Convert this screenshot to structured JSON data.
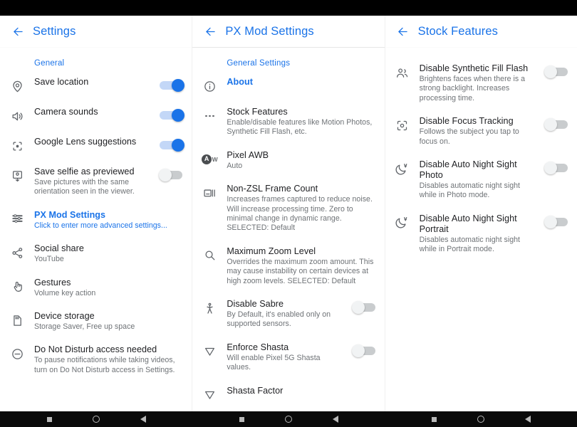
{
  "colors": {
    "accent": "#1a73e8",
    "title_text": "#202124",
    "sub_text": "#6e7276",
    "icon": "#5f6368",
    "toggle_on": "#1a73e8",
    "toggle_on_track": "#c3d7f7",
    "toggle_off": "#f1f3f4",
    "toggle_off_track": "#c9ccce",
    "statusbar": "#000000",
    "navbar": "#0a0a0a",
    "background": "#ffffff"
  },
  "panels": [
    {
      "key": "settings",
      "appbar": {
        "back_label": "back-arrow",
        "title": "Settings"
      },
      "section_header": "General",
      "items": [
        {
          "icon": "location-pin-icon",
          "title": "Save location",
          "sub": "",
          "toggle": "on"
        },
        {
          "icon": "volume-up-icon",
          "title": "Camera sounds",
          "sub": "",
          "toggle": "on"
        },
        {
          "icon": "google-lens-icon",
          "title": "Google Lens suggestions",
          "sub": "",
          "toggle": "on"
        },
        {
          "icon": "selfie-flip-icon",
          "title": "Save selfie as previewed",
          "sub": "Save pictures with the same orientation seen in the viewer.",
          "toggle": "off"
        },
        {
          "icon": "tune-stack-icon",
          "title": "PX Mod Settings",
          "sub": "Click to enter more advanced settings...",
          "toggle": "none",
          "accent": true
        },
        {
          "icon": "share-icon",
          "title": "Social share",
          "sub": "YouTube",
          "toggle": "none"
        },
        {
          "icon": "gesture-tap-icon",
          "title": "Gestures",
          "sub": "Volume key action",
          "toggle": "none"
        },
        {
          "icon": "sd-card-icon",
          "title": "Device storage",
          "sub": "Storage Saver, Free up space",
          "toggle": "none"
        },
        {
          "icon": "do-not-disturb-icon",
          "title": "Do Not Disturb access needed",
          "sub": "To pause notifications while taking videos, turn on Do Not Disturb access in Settings.",
          "toggle": "none"
        }
      ]
    },
    {
      "key": "px-mod-settings",
      "appbar": {
        "back_label": "back-arrow",
        "title": "PX Mod Settings"
      },
      "section_header": "General Settings",
      "items": [
        {
          "icon": "info-icon",
          "title": "About",
          "sub": "",
          "toggle": "none",
          "accent": true
        },
        {
          "icon": "more-horizontal-icon",
          "title": "Stock Features",
          "sub": "Enable/disable features like Motion Photos, Synthetic Fill Flash, etc.",
          "toggle": "none"
        },
        {
          "icon": "awb-badge-icon",
          "title": "Pixel AWB",
          "sub": "Auto",
          "toggle": "none"
        },
        {
          "icon": "frame-count-icon",
          "title": "Non-ZSL Frame Count",
          "sub": "Increases frames captured to reduce noise. Will increase processing time. Zero to minimal change in dynamic range. SELECTED: Default",
          "toggle": "none"
        },
        {
          "icon": "magnifier-icon",
          "title": "Maximum Zoom Level",
          "sub": "Overrides the maximum zoom amount. This may cause instability on certain devices at high zoom levels. SELECTED: Default",
          "toggle": "none"
        },
        {
          "icon": "sabre-person-icon",
          "title": "Disable Sabre",
          "sub": "By Default, it's enabled only on supported sensors.",
          "toggle": "off"
        },
        {
          "icon": "triangle-down-icon",
          "title": "Enforce Shasta",
          "sub": "Will enable Pixel 5G Shasta values.",
          "toggle": "off"
        },
        {
          "icon": "triangle-down-icon",
          "title": "Shasta Factor",
          "sub": "",
          "toggle": "none"
        }
      ]
    },
    {
      "key": "stock-features",
      "appbar": {
        "back_label": "back-arrow",
        "title": "Stock Features"
      },
      "section_header": "",
      "items": [
        {
          "icon": "people-icon",
          "title": "Disable Synthetic Fill Flash",
          "sub": "Brightens faces when there is a strong backlight. Increases processing time.",
          "toggle": "off"
        },
        {
          "icon": "focus-tracking-icon",
          "title": "Disable Focus Tracking",
          "sub": "Follows the subject you tap to focus on.",
          "toggle": "off"
        },
        {
          "icon": "night-sight-auto-icon",
          "title": "Disable Auto Night Sight Photo",
          "sub": "Disables automatic night sight while in Photo mode.",
          "toggle": "off"
        },
        {
          "icon": "night-sight-auto-icon",
          "title": "Disable Auto Night Sight Portrait",
          "sub": "Disables automatic night sight while in Portrait mode.",
          "toggle": "off"
        }
      ]
    }
  ],
  "navbar": {
    "buttons": [
      "recents-square-icon",
      "home-circle-icon",
      "back-triangle-icon"
    ]
  }
}
